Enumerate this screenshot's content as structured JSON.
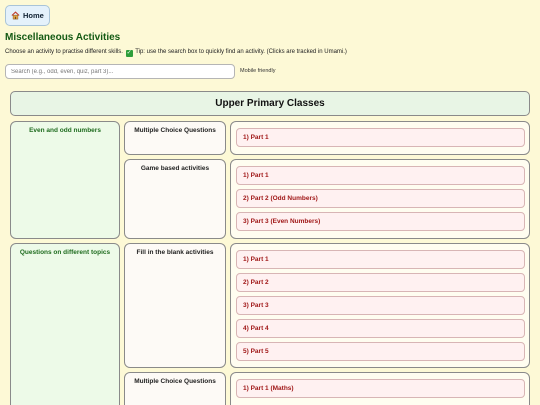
{
  "home": {
    "label": "Home"
  },
  "page": {
    "title": "Miscellaneous Activities",
    "intro_before": "Choose an activity to practise different skills.",
    "intro_after": "Tip: use the search box to quickly find an activity. (Clicks are tracked in Umami.)"
  },
  "search": {
    "placeholder": "Search (e.g., odd, even, quiz, part 3)...",
    "value": ""
  },
  "mobile_note": "Mobile friendly",
  "section": {
    "title": "Upper Primary Classes"
  },
  "topics": [
    {
      "label": "Even and odd numbers",
      "groups": [
        {
          "type": "Multiple Choice Questions",
          "parts": [
            "1) Part 1"
          ]
        },
        {
          "type": "Game based activities",
          "parts": [
            "1) Part 1",
            "2) Part 2 (Odd Numbers)",
            "3) Part 3 (Even Numbers)"
          ]
        }
      ]
    },
    {
      "label": "Questions on different topics",
      "groups": [
        {
          "type": "Fill in the blank activities",
          "parts": [
            "1) Part 1",
            "2) Part 2",
            "3) Part 3",
            "4) Part 4",
            "5) Part 5"
          ]
        },
        {
          "type": "Multiple Choice Questions",
          "parts": [
            "1) Part 1 (Maths)"
          ]
        }
      ]
    }
  ],
  "colors": {
    "background": "#fdf9d6",
    "title": "#145a14",
    "part_text": "#a01818",
    "part_bg": "#fff1f1"
  }
}
